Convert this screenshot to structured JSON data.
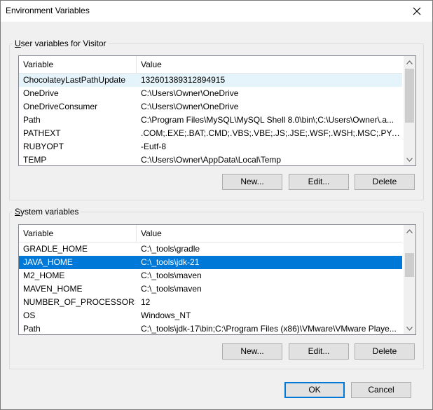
{
  "window": {
    "title": "Environment Variables"
  },
  "user_group": {
    "label": "User variables for Visitor",
    "header": {
      "variable": "Variable",
      "value": "Value"
    },
    "rows": [
      {
        "variable": "ChocolateyLastPathUpdate",
        "value": "132601389312894915"
      },
      {
        "variable": "OneDrive",
        "value": "C:\\Users\\Owner\\OneDrive"
      },
      {
        "variable": "OneDriveConsumer",
        "value": "C:\\Users\\Owner\\OneDrive"
      },
      {
        "variable": "Path",
        "value": "C:\\Program Files\\MySQL\\MySQL Shell 8.0\\bin\\;C:\\Users\\Owner\\.a..."
      },
      {
        "variable": "PATHEXT",
        "value": ".COM;.EXE;.BAT;.CMD;.VBS;.VBE;.JS;.JSE;.WSF;.WSH;.MSC;.PY;.PYW;...."
      },
      {
        "variable": "RUBYOPT",
        "value": "-Eutf-8"
      },
      {
        "variable": "TEMP",
        "value": "C:\\Users\\Owner\\AppData\\Local\\Temp"
      }
    ],
    "buttons": {
      "new": "New...",
      "edit": "Edit...",
      "delete": "Delete"
    }
  },
  "system_group": {
    "label": "System variables",
    "header": {
      "variable": "Variable",
      "value": "Value"
    },
    "rows": [
      {
        "variable": "GRADLE_HOME",
        "value": "C:\\_tools\\gradle"
      },
      {
        "variable": "JAVA_HOME",
        "value": "C:\\_tools\\jdk-21"
      },
      {
        "variable": "M2_HOME",
        "value": "C:\\_tools\\maven"
      },
      {
        "variable": "MAVEN_HOME",
        "value": "C:\\_tools\\maven"
      },
      {
        "variable": "NUMBER_OF_PROCESSORS",
        "value": "12"
      },
      {
        "variable": "OS",
        "value": "Windows_NT"
      },
      {
        "variable": "Path",
        "value": "C:\\_tools\\jdk-17\\bin;C:\\Program Files (x86)\\VMware\\VMware Playe..."
      }
    ],
    "selected_row": "JAVA_HOME",
    "buttons": {
      "new": "New...",
      "edit": "Edit...",
      "delete": "Delete"
    }
  },
  "footer": {
    "ok": "OK",
    "cancel": "Cancel"
  },
  "colors": {
    "selection": "#0078d7",
    "hover": "#e5f3fb",
    "accent": "#0078d7"
  }
}
